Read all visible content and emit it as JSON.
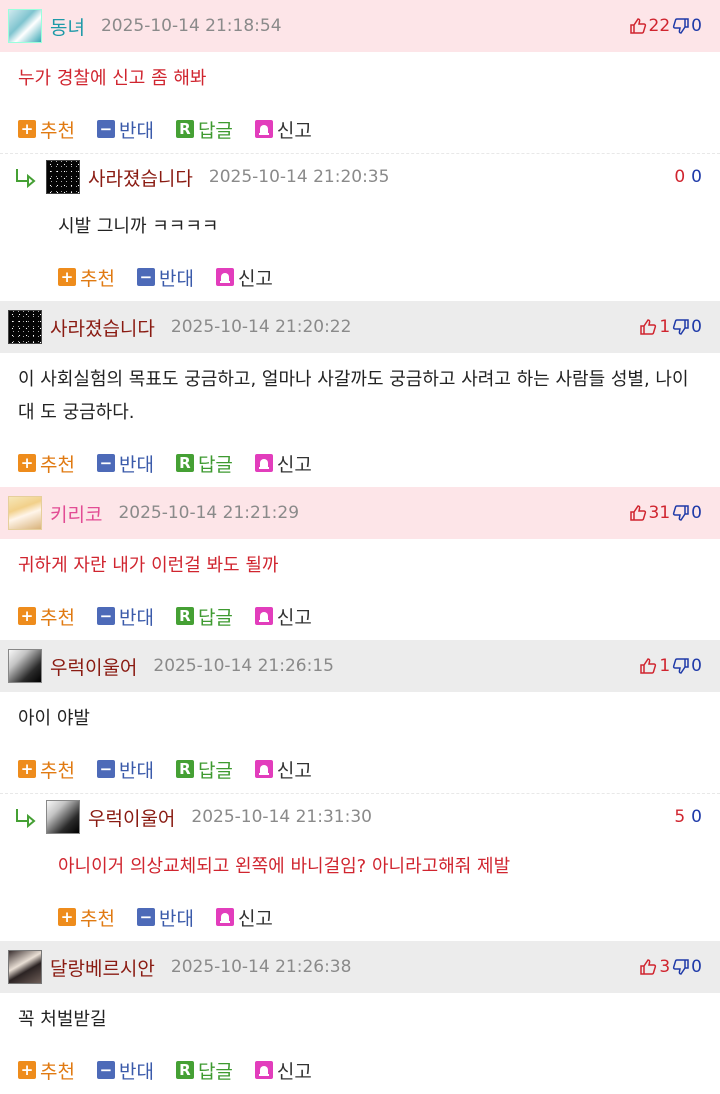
{
  "actions": {
    "recommend": "추천",
    "oppose": "반대",
    "reply": "답글",
    "report": "신고"
  },
  "comments": [
    {
      "author": "동녀",
      "time": "2025-10-14 21:18:54",
      "up": "22",
      "down": "0",
      "text": "누가 경찰에 신고 좀 해봐"
    },
    {
      "author": "사라졌습니다",
      "time": "2025-10-14 21:20:35",
      "up": "0",
      "down": "0",
      "text": "시발 그니까 ㅋㅋㅋㅋ"
    },
    {
      "author": "사라졌습니다",
      "time": "2025-10-14 21:20:22",
      "up": "1",
      "down": "0",
      "text": "이 사회실험의 목표도 궁금하고, 얼마나 사갈까도 궁금하고 사려고 하는 사람들 성별, 나이대 도 궁금하다."
    },
    {
      "author": "키리코",
      "time": "2025-10-14 21:21:29",
      "up": "31",
      "down": "0",
      "text": "귀하게 자란 내가 이런걸 봐도 될까"
    },
    {
      "author": "우럭이울어",
      "time": "2025-10-14 21:26:15",
      "up": "1",
      "down": "0",
      "text": "아이 야발"
    },
    {
      "author": "우럭이울어",
      "time": "2025-10-14 21:31:30",
      "up": "5",
      "down": "0",
      "text": "아니이거 의상교체되고 왼쪽에 바니걸임? 아니라고해줘 제발"
    },
    {
      "author": "달랑베르시안",
      "time": "2025-10-14 21:26:38",
      "up": "3",
      "down": "0",
      "text": "꼭 처벌받길"
    }
  ]
}
